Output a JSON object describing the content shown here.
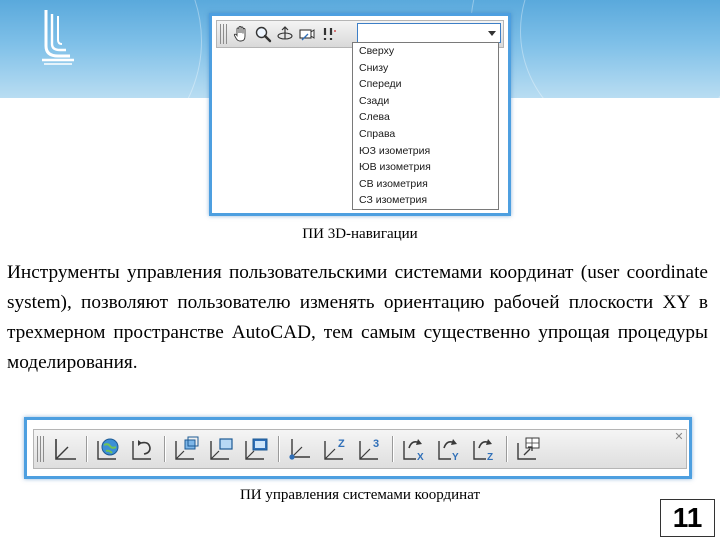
{
  "navigation_figure": {
    "view_select_value": "",
    "view_options": [
      "Сверху",
      "Снизу",
      "Спереди",
      "Сзади",
      "Слева",
      "Справа",
      "ЮЗ изометрия",
      "ЮВ изометрия",
      "СВ изометрия",
      "СЗ изометрия"
    ],
    "icons": [
      "pan-hand-icon",
      "zoom-icon",
      "orbit-icon",
      "camera-icon",
      "walk-icon"
    ],
    "caption": "ПИ 3D-навигации"
  },
  "body_text": "Инструменты управления пользовательскими системами координат (user coordinate system), позволяют пользователю изменять ориентацию рабочей плоскости XY в трехмерном пространстве AutoCAD, тем самым существенно упрощая процедуры моделирования.",
  "ucs_figure": {
    "icons": [
      "ucs-icon",
      "ucs-world-icon",
      "ucs-previous-icon",
      "ucs-face-icon",
      "ucs-object-icon",
      "ucs-view-icon",
      "ucs-origin-icon",
      "ucs-z-axis-icon",
      "ucs-3point-icon",
      "ucs-rotate-x-icon",
      "ucs-rotate-y-icon",
      "ucs-rotate-z-icon",
      "ucs-apply-icon"
    ],
    "axis_letters": {
      "z": "Z",
      "three": "3",
      "x": "X",
      "y": "Y"
    },
    "caption": "ПИ управления системами координат"
  },
  "page_number": "11",
  "colors": {
    "accent_border": "#4d9fe0",
    "header_band": "#7fc0e8",
    "icon_blue": "#2f6fb8",
    "icon_dark": "#3a3a3a"
  }
}
